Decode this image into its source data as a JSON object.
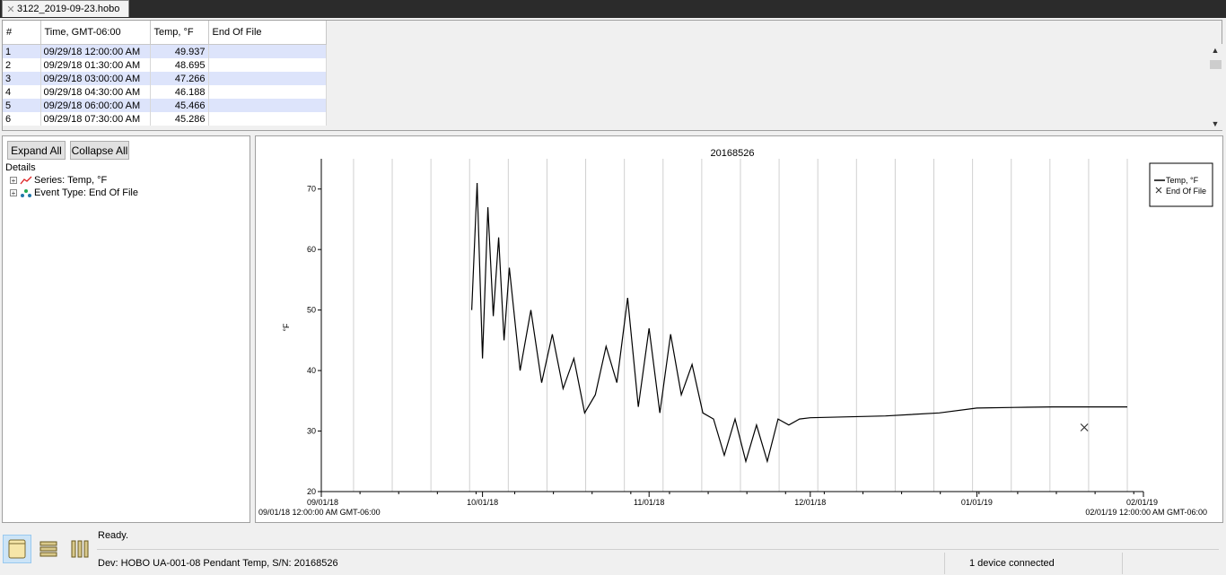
{
  "tab": {
    "label": "3122_2019-09-23.hobo"
  },
  "table": {
    "headers": [
      "#",
      "Time, GMT-06:00",
      "Temp, °F",
      "End Of File"
    ],
    "rows": [
      [
        "1",
        "09/29/18 12:00:00 AM",
        "49.937",
        ""
      ],
      [
        "2",
        "09/29/18 01:30:00 AM",
        "48.695",
        ""
      ],
      [
        "3",
        "09/29/18 03:00:00 AM",
        "47.266",
        ""
      ],
      [
        "4",
        "09/29/18 04:30:00 AM",
        "46.188",
        ""
      ],
      [
        "5",
        "09/29/18 06:00:00 AM",
        "45.466",
        ""
      ],
      [
        "6",
        "09/29/18 07:30:00 AM",
        "45.286",
        ""
      ]
    ]
  },
  "tree": {
    "expand_all": "Expand All",
    "collapse_all": "Collapse All",
    "root": "Details",
    "items": [
      {
        "label": "Series: Temp, °F",
        "icon": "line-series-icon"
      },
      {
        "label": "Event Type: End Of File",
        "icon": "event-type-icon"
      }
    ]
  },
  "chart_data": {
    "type": "line",
    "title": "20168526",
    "ylabel": "°F",
    "xlabel": "",
    "ylim": [
      20,
      75
    ],
    "yticks": [
      20,
      30,
      40,
      50,
      60,
      70
    ],
    "x_tick_labels": [
      "09/01/18",
      "10/01/18",
      "11/01/18",
      "12/01/18",
      "01/01/19",
      "02/01/19"
    ],
    "x_start_label": "09/01/18 12:00:00 AM GMT-06:00",
    "x_end_label": "02/01/19 12:00:00 AM GMT-06:00",
    "legend": {
      "placement": "top-right",
      "entries": [
        "Temp, °F",
        "End Of File"
      ]
    },
    "grid": "vertical",
    "series": [
      {
        "name": "Temp, °F",
        "x": [
          "2018-09-29",
          "2018-09-30",
          "2018-10-01",
          "2018-10-02",
          "2018-10-03",
          "2018-10-04",
          "2018-10-05",
          "2018-10-06",
          "2018-10-08",
          "2018-10-10",
          "2018-10-12",
          "2018-10-14",
          "2018-10-16",
          "2018-10-18",
          "2018-10-20",
          "2018-10-22",
          "2018-10-24",
          "2018-10-26",
          "2018-10-28",
          "2018-10-30",
          "2018-11-01",
          "2018-11-03",
          "2018-11-05",
          "2018-11-07",
          "2018-11-09",
          "2018-11-11",
          "2018-11-13",
          "2018-11-15",
          "2018-11-17",
          "2018-11-19",
          "2018-11-21",
          "2018-11-23",
          "2018-11-25",
          "2018-11-27",
          "2018-11-29",
          "2018-12-01",
          "2018-12-15",
          "2018-12-25",
          "2019-01-01",
          "2019-01-08",
          "2019-01-15",
          "2019-01-22",
          "2019-01-29"
        ],
        "y": [
          50,
          71,
          42,
          67,
          49,
          62,
          45,
          57,
          40,
          50,
          38,
          46,
          37,
          42,
          33,
          36,
          44,
          38,
          52,
          34,
          47,
          33,
          46,
          36,
          41,
          33,
          32,
          26,
          32,
          25,
          31,
          25,
          32,
          31,
          32,
          32.2,
          32.5,
          33,
          33.8,
          33.9,
          34,
          34,
          34
        ]
      }
    ],
    "events": [
      {
        "name": "End Of File",
        "x": "2019-01-21",
        "y": 30.6
      }
    ]
  },
  "status": {
    "ready": "Ready.",
    "device": "Dev: HOBO UA-001-08 Pendant Temp, S/N: 20168526",
    "connected": "1 device connected"
  }
}
